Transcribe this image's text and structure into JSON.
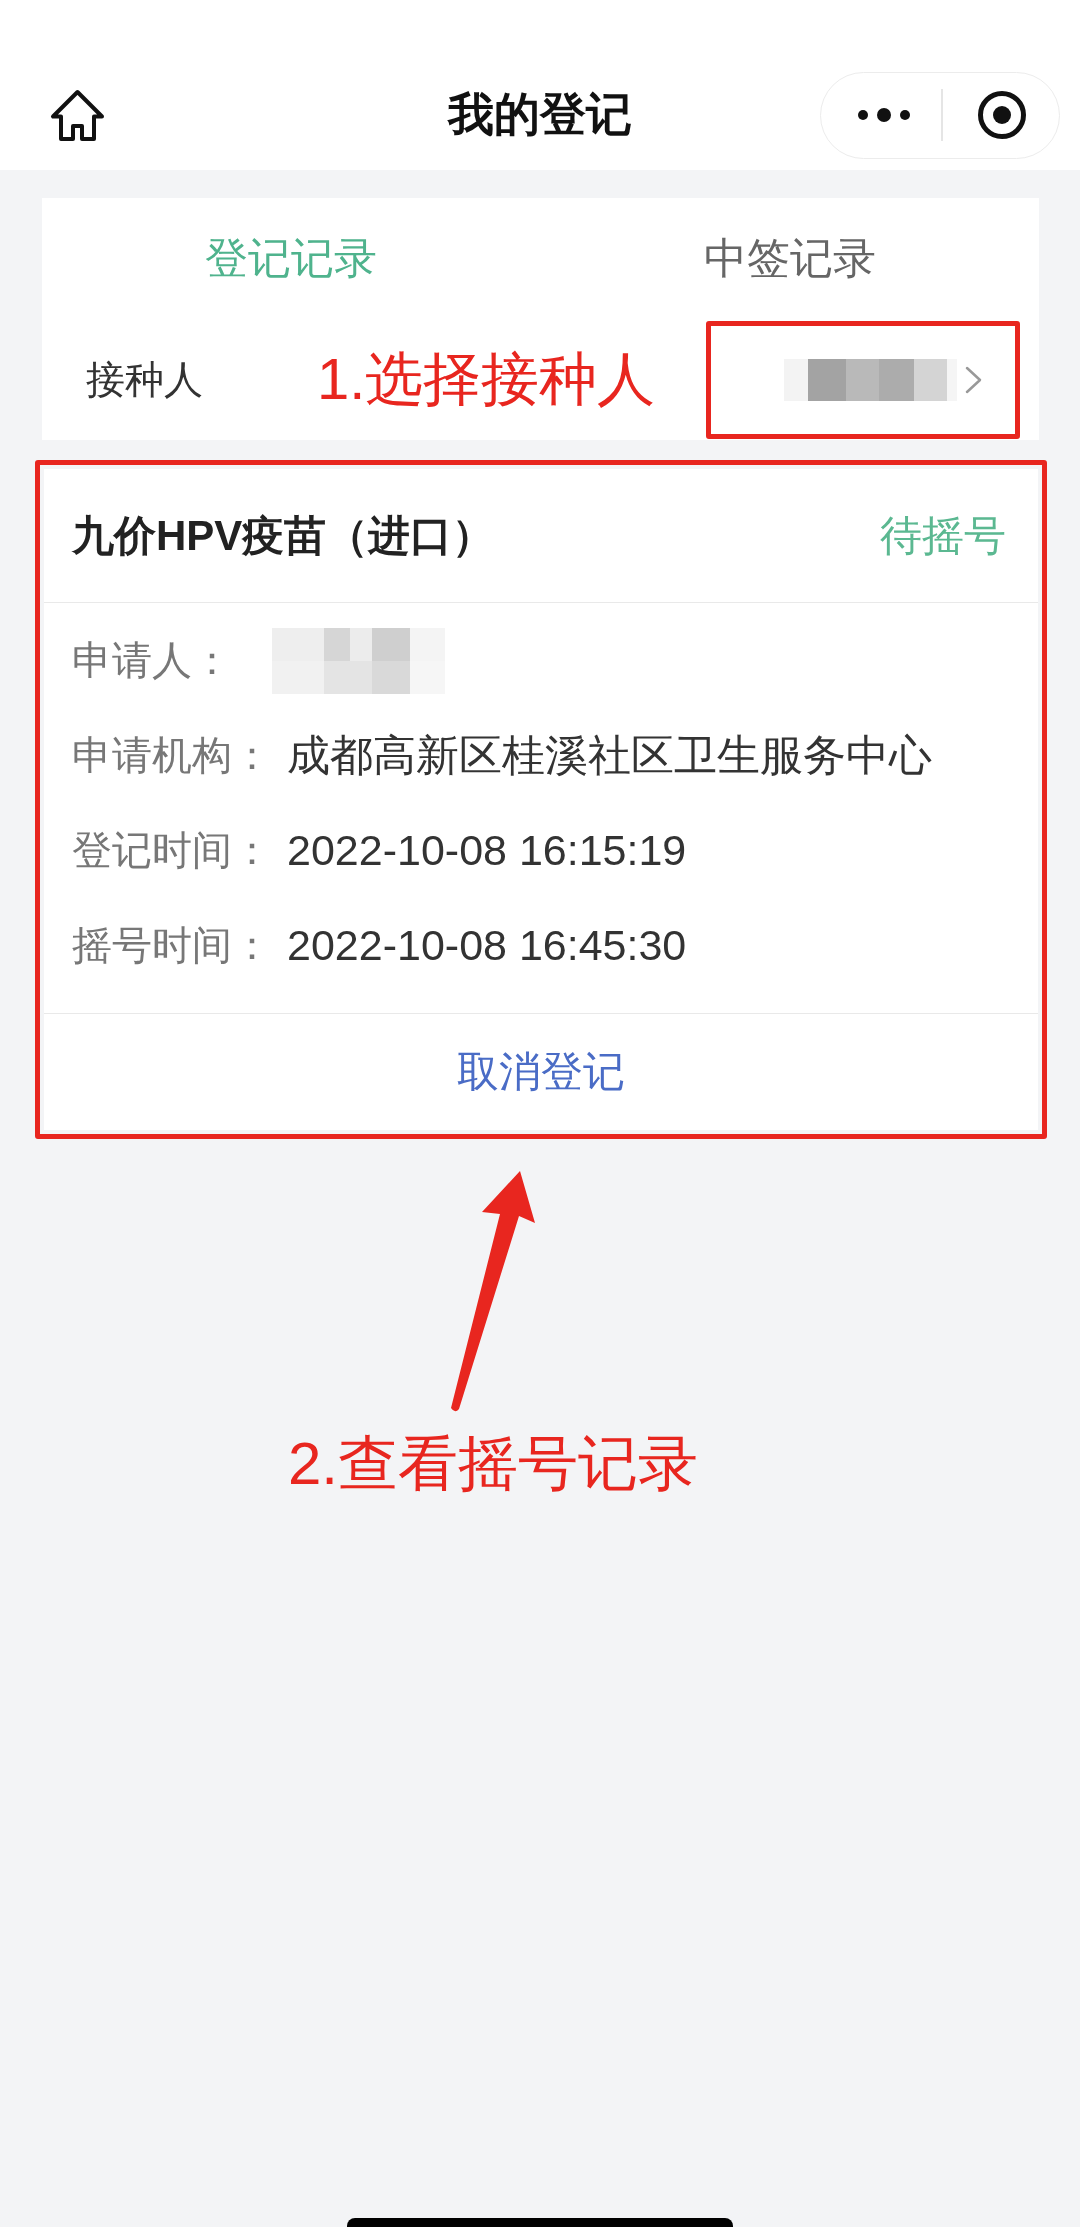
{
  "nav_bar": {
    "title": "我的登记"
  },
  "tabs": [
    {
      "label": "登记记录",
      "selected": true
    },
    {
      "label": "中签记录",
      "selected": false
    }
  ],
  "recipient": {
    "label": "接种人",
    "redacted": true
  },
  "registration": {
    "title": "九价HPV疫苗（进口）",
    "status": "待摇号",
    "fields": [
      {
        "label": "申请人：",
        "redacted": true
      },
      {
        "label": "申请机构：",
        "value": "成都高新区桂溪社区卫生服务中心",
        "redacted": false
      },
      {
        "label": "登记时间：",
        "value": "2022-10-08 16:15:19",
        "redacted": false
      },
      {
        "label": "摇号时间：",
        "value": "2022-10-08 16:45:30",
        "redacted": false
      }
    ],
    "action": "取消登记"
  },
  "annotations": [
    {
      "text": "1.选择接种人"
    },
    {
      "text": "2.查看摇号记录"
    }
  ]
}
